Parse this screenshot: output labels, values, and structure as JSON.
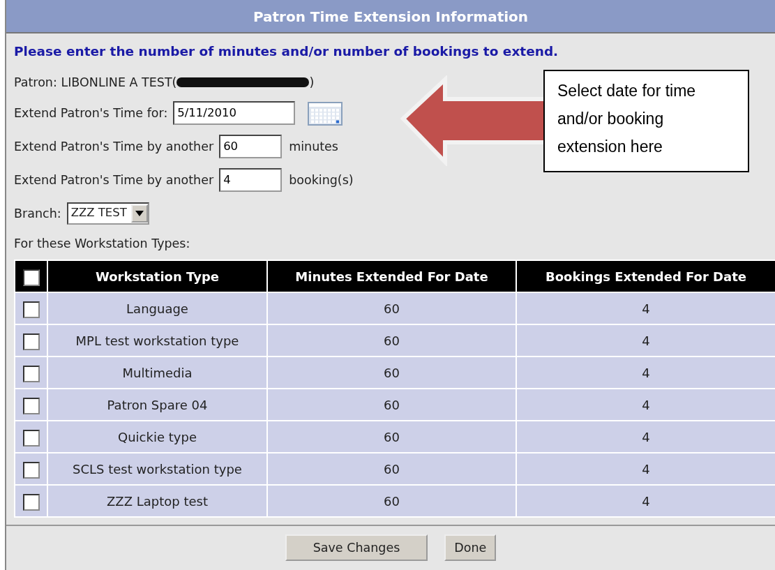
{
  "window": {
    "title": "Patron Time Extension Information"
  },
  "instruction": "Please enter the number of minutes and/or number of bookings to extend.",
  "patron": {
    "text_before": "Patron: LIBONLINE A TEST(",
    "redacted": true,
    "text_after": ")"
  },
  "date_row": {
    "label": "Extend Patron's Time for:",
    "value": "5/11/2010"
  },
  "minutes_row": {
    "label": "Extend Patron's Time by another",
    "value": "60",
    "unit": "minutes"
  },
  "bookings_row": {
    "label": "Extend Patron's Time by another",
    "value": "4",
    "unit": "booking(s)"
  },
  "branch": {
    "label": "Branch:",
    "value": "ZZZ TEST"
  },
  "table_caption": "For these Workstation Types:",
  "table": {
    "select_all_checked": false,
    "columns": [
      "Workstation Type",
      "Minutes Extended For Date",
      "Bookings Extended For Date"
    ],
    "rows": [
      {
        "checked": false,
        "cells": [
          "Language",
          "60",
          "4"
        ]
      },
      {
        "checked": false,
        "cells": [
          "MPL test workstation type",
          "60",
          "4"
        ]
      },
      {
        "checked": false,
        "cells": [
          "Multimedia",
          "60",
          "4"
        ]
      },
      {
        "checked": false,
        "cells": [
          "Patron Spare 04",
          "60",
          "4"
        ]
      },
      {
        "checked": false,
        "cells": [
          "Quickie type",
          "60",
          "4"
        ]
      },
      {
        "checked": false,
        "cells": [
          "SCLS test workstation type",
          "60",
          "4"
        ]
      },
      {
        "checked": false,
        "cells": [
          "ZZZ Laptop test",
          "60",
          "4"
        ]
      }
    ]
  },
  "buttons": [
    "Save Changes",
    "Done"
  ],
  "callout": {
    "text": "Select date for time and/or booking extension here"
  }
}
